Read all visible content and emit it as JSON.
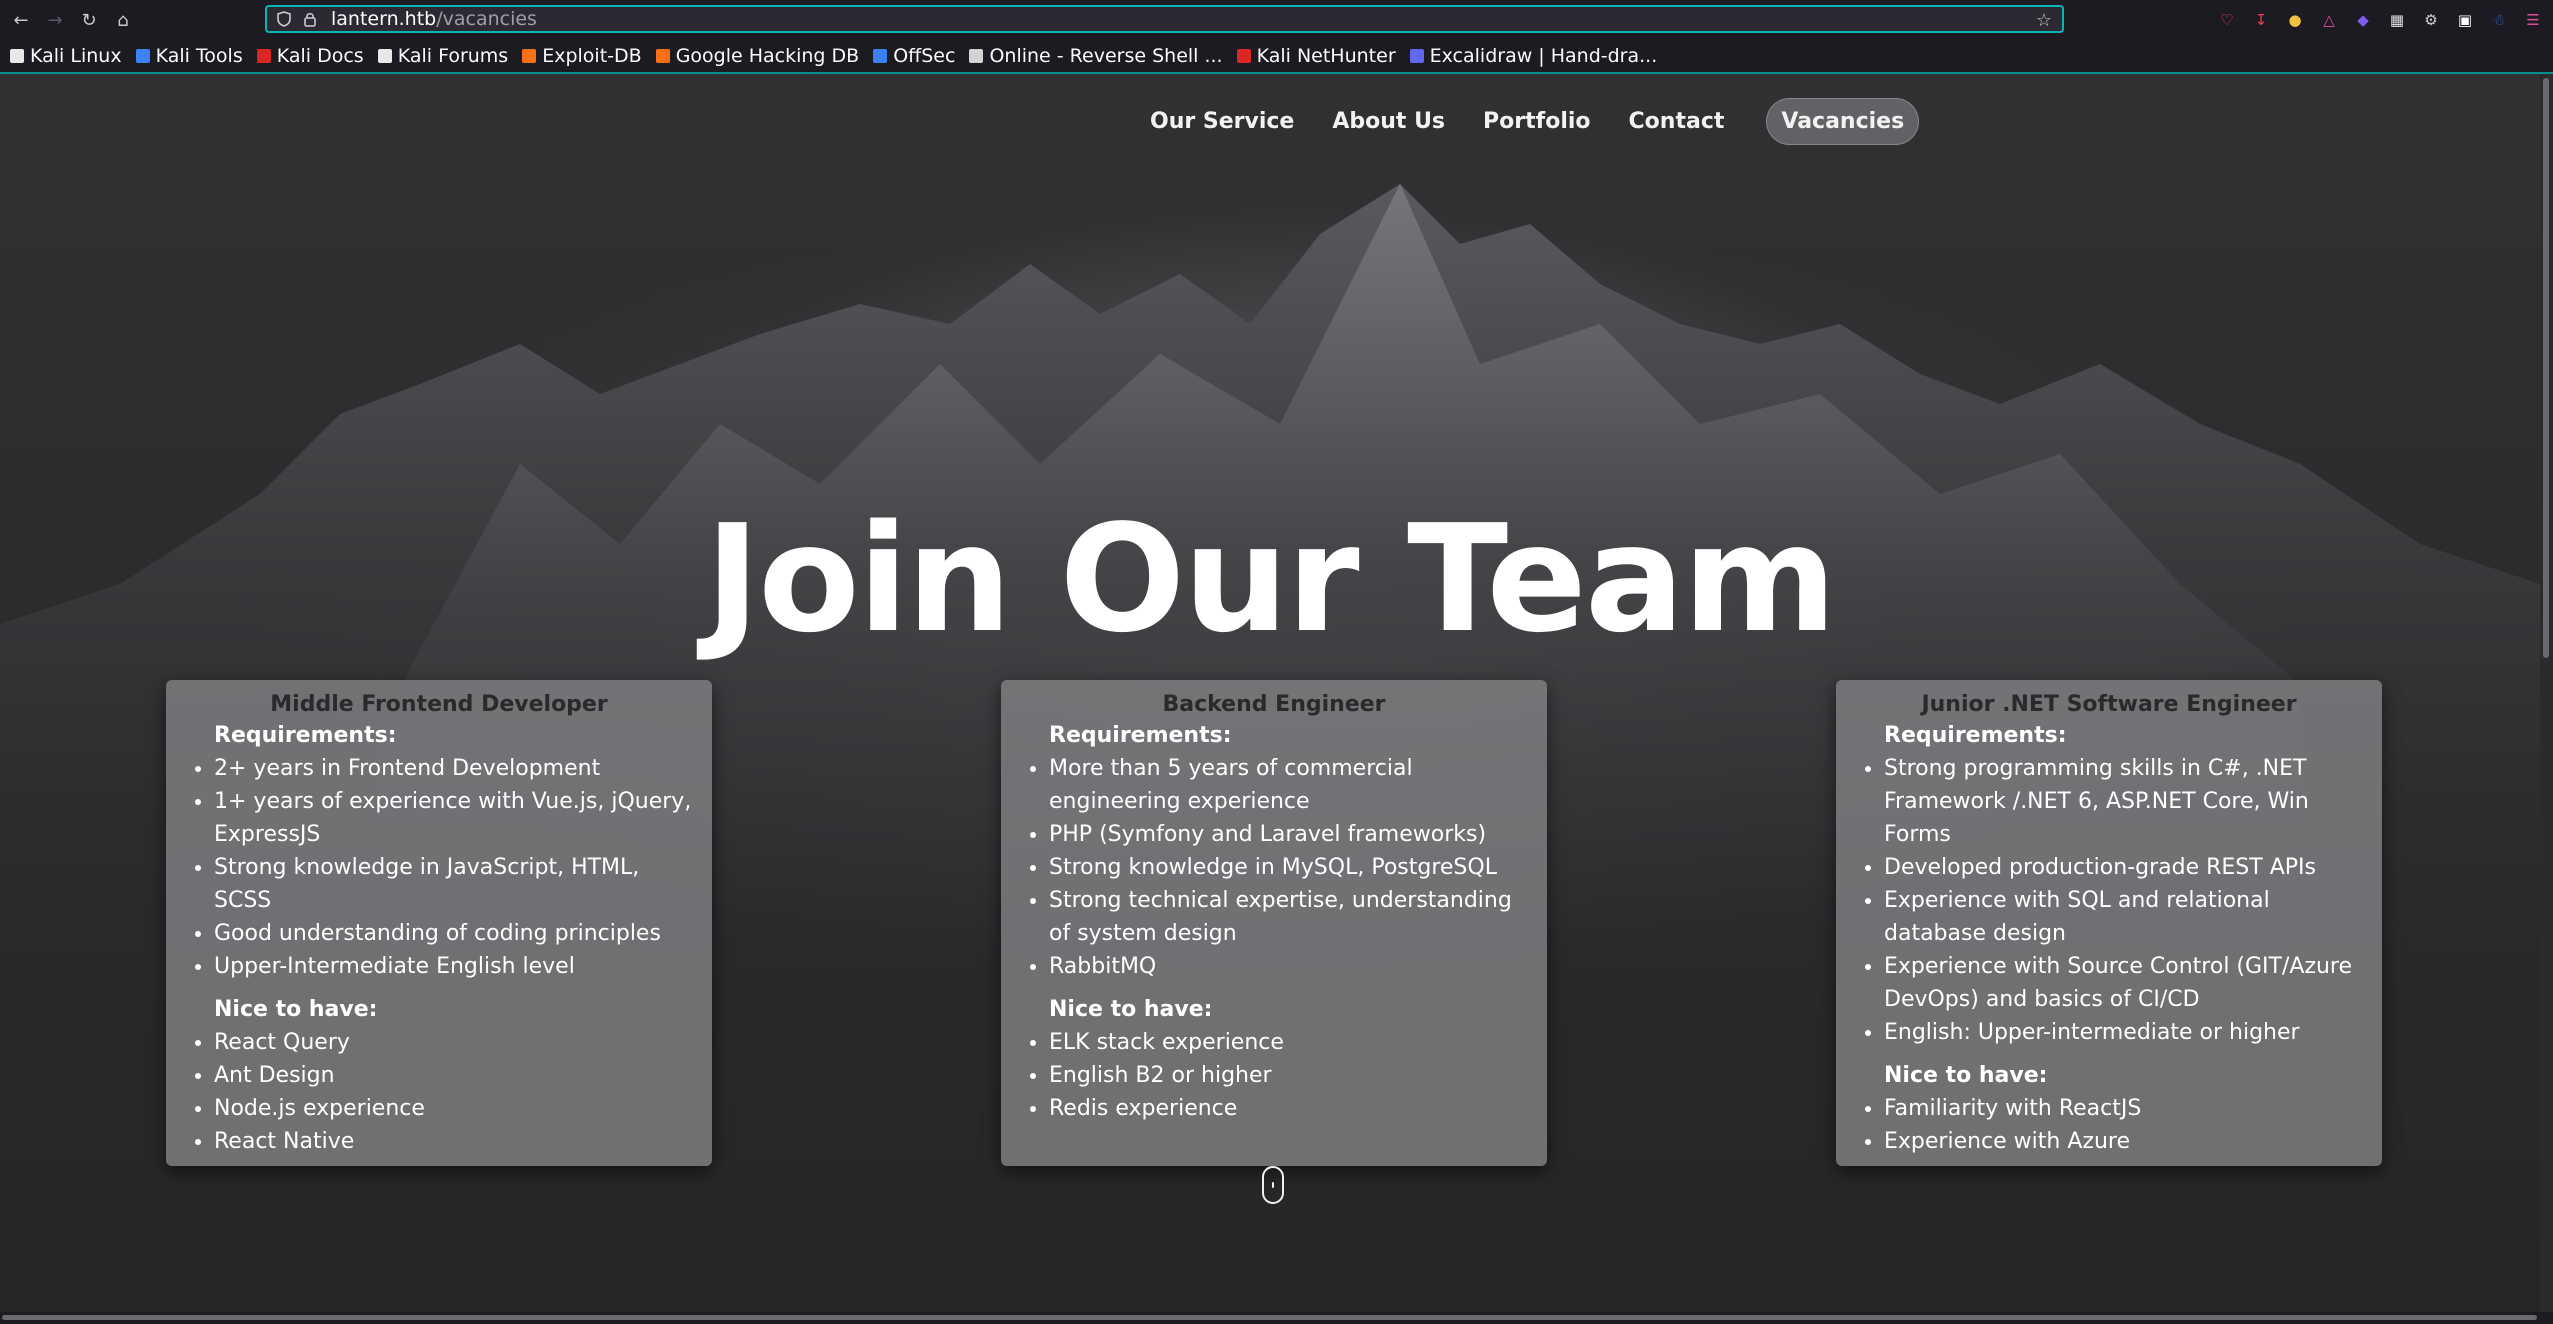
{
  "browser": {
    "url_host": "lantern.htb",
    "url_path": "/vacancies",
    "bookmarks": [
      {
        "label": "Kali Linux",
        "color": "#e8e8e8"
      },
      {
        "label": "Kali Tools",
        "color": "#3b82f6"
      },
      {
        "label": "Kali Docs",
        "color": "#dc2626"
      },
      {
        "label": "Kali Forums",
        "color": "#e8e8e8"
      },
      {
        "label": "Exploit-DB",
        "color": "#f97316"
      },
      {
        "label": "Google Hacking DB",
        "color": "#f97316"
      },
      {
        "label": "OffSec",
        "color": "#3b82f6"
      },
      {
        "label": "Online - Reverse Shell ...",
        "color": "#d4d4d4"
      },
      {
        "label": "Kali NetHunter",
        "color": "#dc2626"
      },
      {
        "label": "Excalidraw | Hand-dra...",
        "color": "#6366f1"
      }
    ]
  },
  "nav": {
    "items": [
      "Our Service",
      "About Us",
      "Portfolio",
      "Contact"
    ],
    "active": "Vacancies"
  },
  "hero": {
    "title": "Join Our Team"
  },
  "vacancies": [
    {
      "title": "Middle Frontend Developer",
      "requirements_label": "Requirements:",
      "requirements": [
        "2+ years in Frontend Development",
        "1+ years of experience with Vue.js, jQuery, ExpressJS",
        "Strong knowledge in JavaScript, HTML, SCSS",
        "Good understanding of coding principles",
        "Upper-Intermediate English level"
      ],
      "nice_label": "Nice to have:",
      "nice": [
        "React Query",
        "Ant Design",
        "Node.js experience",
        "React Native"
      ]
    },
    {
      "title": "Backend Engineer",
      "requirements_label": "Requirements:",
      "requirements": [
        "More than 5 years of commercial engineering experience",
        "PHP (Symfony and Laravel frameworks)",
        "Strong knowledge in MySQL, PostgreSQL",
        "Strong technical expertise, understanding of system design",
        "RabbitMQ"
      ],
      "nice_label": "Nice to have:",
      "nice": [
        "ELK stack experience",
        "English B2 or higher",
        "Redis experience"
      ]
    },
    {
      "title": "Junior .NET Software Engineer",
      "requirements_label": "Requirements:",
      "requirements": [
        "Strong programming skills in C#, .NET Framework /.NET 6, ASP.NET Core, Win Forms",
        "Developed production-grade REST APIs",
        "Experience with SQL and relational database design",
        "Experience with Source Control (GIT/Azure DevOps) and basics of CI/CD",
        "English: Upper-intermediate or higher"
      ],
      "nice_label": "Nice to have:",
      "nice": [
        "Familiarity with ReactJS",
        "Experience with Azure"
      ]
    }
  ]
}
